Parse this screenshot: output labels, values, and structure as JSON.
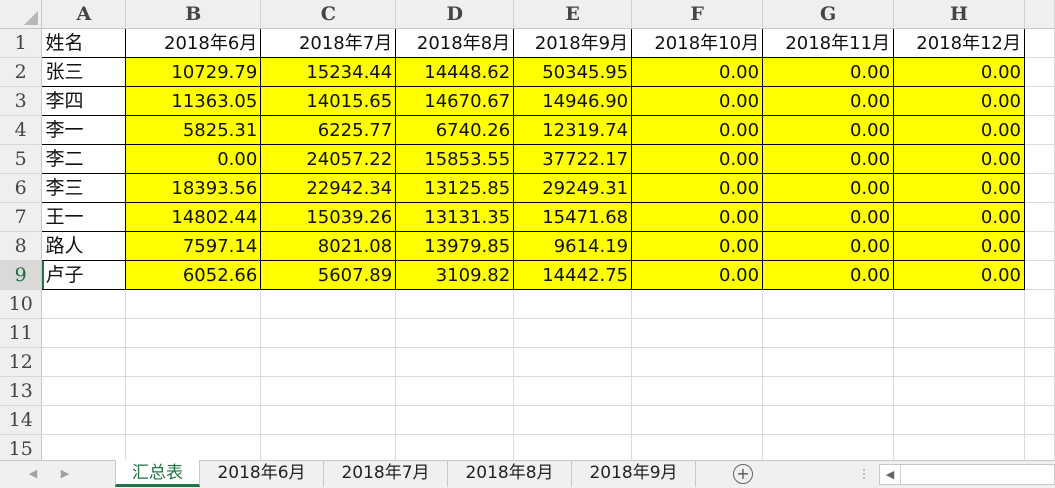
{
  "columns": [
    "A",
    "B",
    "C",
    "D",
    "E",
    "F",
    "G",
    "H"
  ],
  "rows": [
    {
      "num": "1",
      "cells": [
        "姓名",
        "2018年6月",
        "2018年7月",
        "2018年8月",
        "2018年9月",
        "2018年10月",
        "2018年11月",
        "2018年12月"
      ]
    },
    {
      "num": "2",
      "cells": [
        "张三",
        "10729.79",
        "15234.44",
        "14448.62",
        "50345.95",
        "0.00",
        "0.00",
        "0.00"
      ]
    },
    {
      "num": "3",
      "cells": [
        "李四",
        "11363.05",
        "14015.65",
        "14670.67",
        "14946.90",
        "0.00",
        "0.00",
        "0.00"
      ]
    },
    {
      "num": "4",
      "cells": [
        "李一",
        "5825.31",
        "6225.77",
        "6740.26",
        "12319.74",
        "0.00",
        "0.00",
        "0.00"
      ]
    },
    {
      "num": "5",
      "cells": [
        "李二",
        "0.00",
        "24057.22",
        "15853.55",
        "37722.17",
        "0.00",
        "0.00",
        "0.00"
      ]
    },
    {
      "num": "6",
      "cells": [
        "李三",
        "18393.56",
        "22942.34",
        "13125.85",
        "29249.31",
        "0.00",
        "0.00",
        "0.00"
      ]
    },
    {
      "num": "7",
      "cells": [
        "王一",
        "14802.44",
        "15039.26",
        "13131.35",
        "15471.68",
        "0.00",
        "0.00",
        "0.00"
      ]
    },
    {
      "num": "8",
      "cells": [
        "路人",
        "7597.14",
        "8021.08",
        "13979.85",
        "9614.19",
        "0.00",
        "0.00",
        "0.00"
      ]
    },
    {
      "num": "9",
      "cells": [
        "卢子",
        "6052.66",
        "5607.89",
        "3109.82",
        "14442.75",
        "0.00",
        "0.00",
        "0.00"
      ]
    },
    {
      "num": "10",
      "cells": [
        "",
        "",
        "",
        "",
        "",
        "",
        "",
        ""
      ]
    },
    {
      "num": "11",
      "cells": [
        "",
        "",
        "",
        "",
        "",
        "",
        "",
        ""
      ]
    },
    {
      "num": "12",
      "cells": [
        "",
        "",
        "",
        "",
        "",
        "",
        "",
        ""
      ]
    },
    {
      "num": "13",
      "cells": [
        "",
        "",
        "",
        "",
        "",
        "",
        "",
        ""
      ]
    },
    {
      "num": "14",
      "cells": [
        "",
        "",
        "",
        "",
        "",
        "",
        "",
        ""
      ]
    },
    {
      "num": "15",
      "cells": [
        "",
        "",
        "",
        "",
        "",
        "",
        "",
        ""
      ]
    }
  ],
  "sheet_tabs": [
    "汇总表",
    "2018年6月",
    "2018年7月",
    "2018年8月",
    "2018年9月"
  ],
  "active_tab": "汇总表",
  "selected_row": "9",
  "highlight_color": "#ffff00",
  "accent_color": "#217346",
  "icons": {
    "prev_sheet": "triangle-left-icon",
    "next_sheet": "triangle-right-icon",
    "add_sheet": "plus-circle-icon",
    "scroll_left": "triangle-left-icon"
  }
}
